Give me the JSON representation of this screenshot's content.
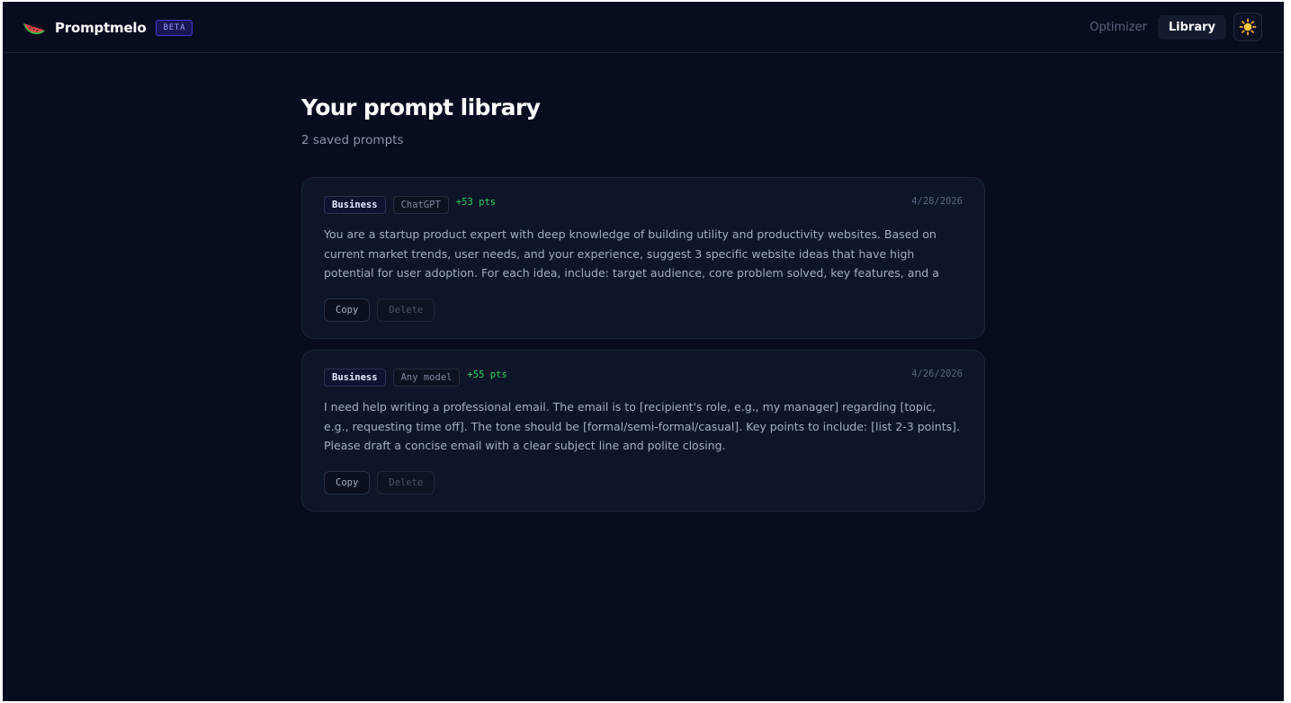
{
  "header": {
    "brand": "Promptmelo",
    "badge": "BETA",
    "nav": [
      {
        "label": "Optimizer",
        "active": false
      },
      {
        "label": "Library",
        "active": true
      }
    ],
    "theme_toggle_icon": "sun-icon"
  },
  "main": {
    "title": "Your prompt library",
    "subtitle": "2 saved prompts",
    "prompts": [
      {
        "category": "Business",
        "model": "ChatGPT",
        "points": "+53 pts",
        "date": "4/28/2026",
        "text": "You are a startup product expert with deep knowledge of building utility and productivity websites. Based on current market trends, user needs, and your experience, suggest 3 specific website ideas that have high potential for user adoption. For each idea, include: target audience, core problem solved, key features, and a rough estimate of…",
        "copy_label": "Copy",
        "delete_label": "Delete"
      },
      {
        "category": "Business",
        "model": "Any model",
        "points": "+55 pts",
        "date": "4/26/2026",
        "text": "I need help writing a professional email. The email is to [recipient's role, e.g., my manager] regarding [topic, e.g., requesting time off]. The tone should be [formal/semi-formal/casual]. Key points to include: [list 2-3 points]. Please draft a concise email with a clear subject line and polite closing.",
        "copy_label": "Copy",
        "delete_label": "Delete"
      }
    ]
  },
  "colors": {
    "background": "#080c1f",
    "card": "#0c1628",
    "points_green": "#2fd35f",
    "beta_accent": "#9aa2ff"
  }
}
